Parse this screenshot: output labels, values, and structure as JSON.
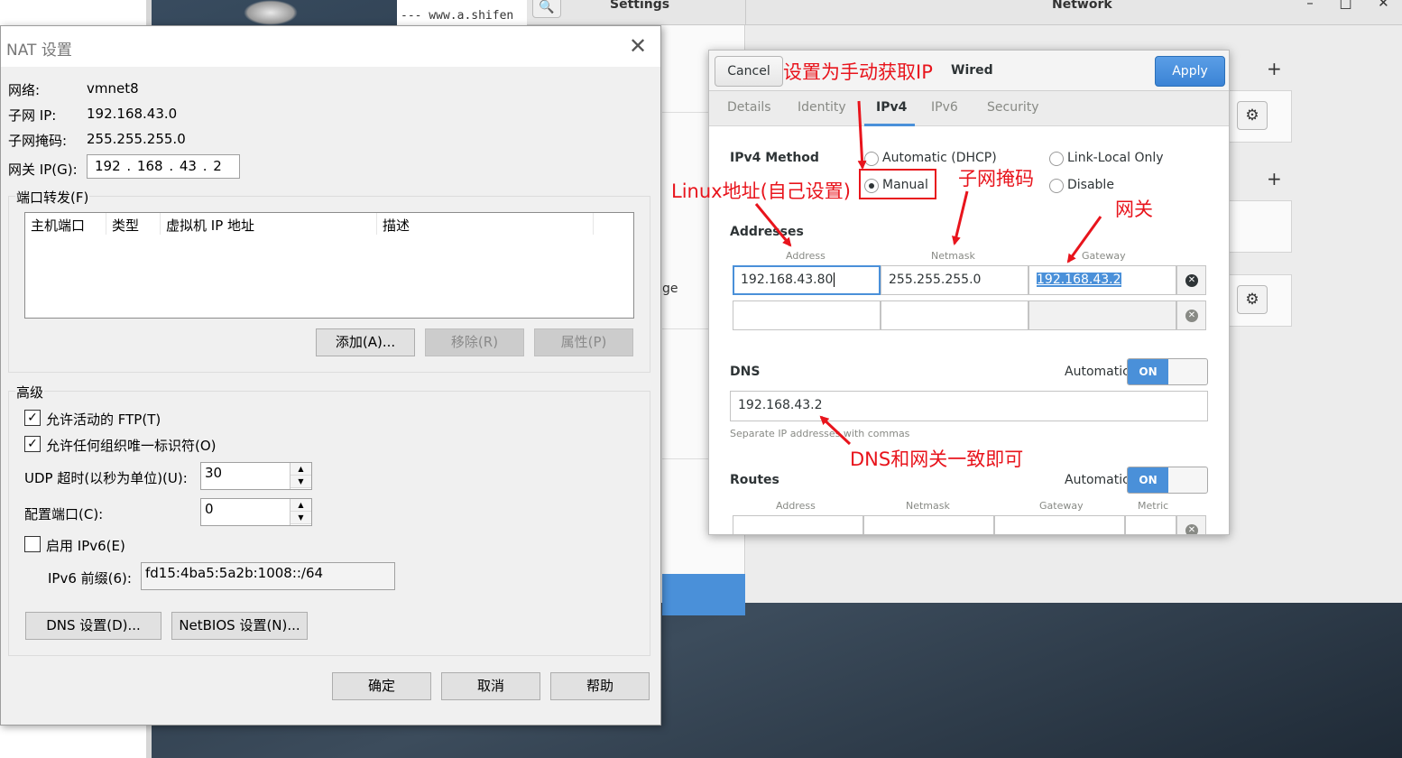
{
  "background": {
    "terminal_text": "--- www.a.shifen",
    "settings_title": "Settings",
    "network_title": "Network",
    "sidebar_partial_text": "ge",
    "window_controls": [
      "–",
      "□",
      "✕"
    ],
    "plus_label": "+",
    "gear_icon": "gear-icon"
  },
  "nat": {
    "title": "NAT 设置",
    "close": "✕",
    "network_label": "网络:",
    "network_value": "vmnet8",
    "subnet_ip_label": "子网 IP:",
    "subnet_ip_value": "192.168.43.0",
    "subnet_mask_label": "子网掩码:",
    "subnet_mask_value": "255.255.255.0",
    "gateway_label": "网关 IP(G):",
    "gateway_value": "192 . 168 . 43  .  2",
    "port_forward_group": "端口转发(F)",
    "columns": [
      "主机端口",
      "类型",
      "虚拟机 IP 地址",
      "描述"
    ],
    "add_button": "添加(A)...",
    "remove_button": "移除(R)",
    "properties_button": "属性(P)",
    "advanced_group": "高级",
    "allow_ftp": "允许活动的 FTP(T)",
    "allow_ftp_checked": true,
    "allow_oui": "允许任何组织唯一标识符(O)",
    "allow_oui_checked": true,
    "udp_timeout_label": "UDP 超时(以秒为单位)(U):",
    "udp_timeout_value": "30",
    "config_port_label": "配置端口(C):",
    "config_port_value": "0",
    "enable_ipv6": "启用 IPv6(E)",
    "enable_ipv6_checked": false,
    "ipv6_prefix_label": "IPv6 前缀(6):",
    "ipv6_prefix_value": "fd15:4ba5:5a2b:1008::/64",
    "dns_button": "DNS 设置(D)...",
    "netbios_button": "NetBIOS 设置(N)...",
    "ok_button": "确定",
    "cancel_button": "取消",
    "help_button": "帮助"
  },
  "wired": {
    "cancel": "Cancel",
    "title": "Wired",
    "apply": "Apply",
    "tabs": [
      "Details",
      "Identity",
      "IPv4",
      "IPv6",
      "Security"
    ],
    "active_tab": "IPv4",
    "method_label": "IPv4 Method",
    "method_options": [
      "Automatic (DHCP)",
      "Manual",
      "Link-Local Only",
      "Disable"
    ],
    "method_selected": "Manual",
    "addresses_label": "Addresses",
    "col_address": "Address",
    "col_netmask": "Netmask",
    "col_gateway": "Gateway",
    "col_metric": "Metric",
    "address_value": "192.168.43.80",
    "netmask_value": "255.255.255.0",
    "gateway_value": "192.168.43.2",
    "dns_label": "DNS",
    "automatic_label": "Automatic",
    "toggle_on": "ON",
    "dns_value": "192.168.43.2",
    "dns_hint": "Separate IP addresses with commas",
    "routes_label": "Routes",
    "clear_icon": "✕"
  },
  "annotations": {
    "manual_ip": "设置为手动获取IP",
    "linux_address": "Linux地址(自己设置)",
    "subnet_mask": "子网掩码",
    "gateway": "网关",
    "dns_same": "DNS和网关一致即可"
  },
  "colors": {
    "annotation": "#e8141c",
    "accent": "#4a90d9"
  }
}
